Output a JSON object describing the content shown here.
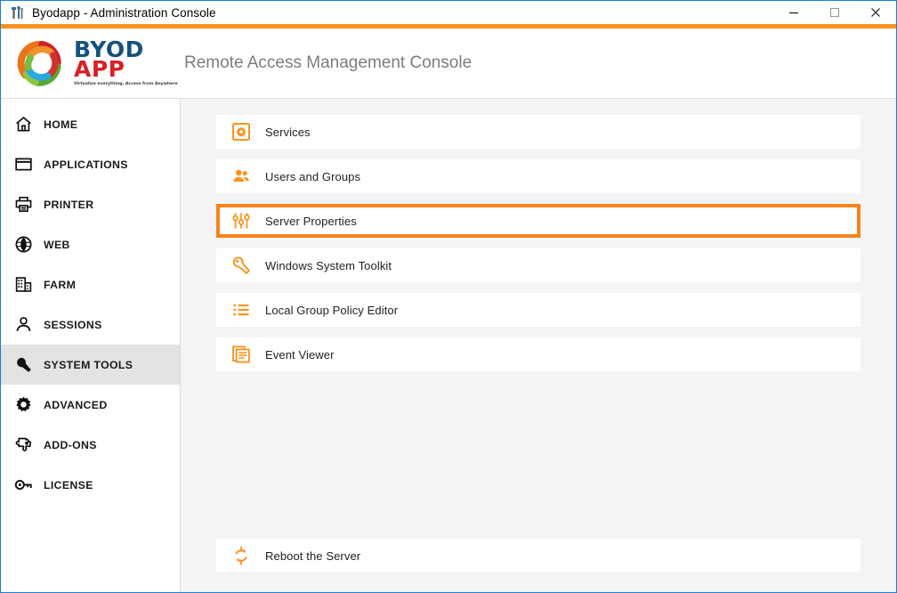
{
  "window": {
    "title": "Byodapp - Administration Console",
    "app_icon": "tools-icon",
    "controls": {
      "minimize": "minimize-icon",
      "maximize": "maximize-icon",
      "close": "close-icon"
    },
    "accent_color": "#f7941e",
    "border_color": "#1a7fd4"
  },
  "header": {
    "logo": {
      "mark": "byodapp-ring-logo",
      "word_top": "BYOD",
      "word_bottom": "APP",
      "tagline": "Virtualize everything, Access from Anywhere",
      "color_top": "#14527d",
      "color_bottom": "#d72027"
    },
    "title": "Remote Access Management Console"
  },
  "sidebar": {
    "active_index": 6,
    "items": [
      {
        "label": "HOME",
        "icon": "home-icon"
      },
      {
        "label": "APPLICATIONS",
        "icon": "window-icon"
      },
      {
        "label": "PRINTER",
        "icon": "printer-icon"
      },
      {
        "label": "WEB",
        "icon": "globe-icon"
      },
      {
        "label": "FARM",
        "icon": "building-icon"
      },
      {
        "label": "SESSIONS",
        "icon": "user-icon"
      },
      {
        "label": "SYSTEM TOOLS",
        "icon": "wrench-icon"
      },
      {
        "label": "ADVANCED",
        "icon": "gear-icon"
      },
      {
        "label": "ADD-ONS",
        "icon": "puzzle-icon"
      },
      {
        "label": "LICENSE",
        "icon": "key-icon"
      }
    ]
  },
  "main": {
    "selected_index": 2,
    "accent_color": "#f7821b",
    "tiles": [
      {
        "label": "Services",
        "icon": "services-gear-icon"
      },
      {
        "label": "Users and Groups",
        "icon": "users-group-icon"
      },
      {
        "label": "Server Properties",
        "icon": "sliders-icon"
      },
      {
        "label": "Windows System Toolkit",
        "icon": "wrench-screwdriver-icon"
      },
      {
        "label": "Local Group Policy Editor",
        "icon": "list-icon"
      },
      {
        "label": "Event Viewer",
        "icon": "event-log-icon"
      }
    ],
    "footer_tile": {
      "label": "Reboot the Server",
      "icon": "refresh-icon"
    }
  }
}
